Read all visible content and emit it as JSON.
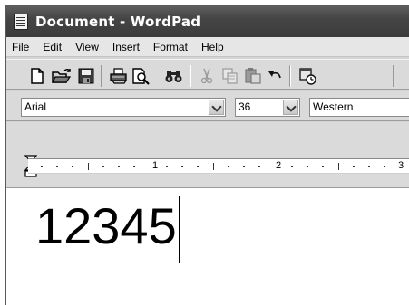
{
  "window": {
    "title": "Document - WordPad"
  },
  "menu": {
    "items": [
      {
        "underline": "F",
        "rest": "ile"
      },
      {
        "underline": "E",
        "rest": "dit"
      },
      {
        "underline": "V",
        "rest": "iew"
      },
      {
        "underline": "I",
        "rest": "nsert"
      },
      {
        "pre": "F",
        "underline": "o",
        "rest": "rmat"
      },
      {
        "underline": "H",
        "rest": "elp"
      }
    ]
  },
  "toolbar": {
    "buttons": [
      "new-icon",
      "open-icon",
      "save-icon",
      "print-icon",
      "print-preview-icon",
      "find-icon",
      "cut-icon",
      "copy-icon",
      "paste-icon",
      "undo-icon",
      "insert-datetime-icon"
    ]
  },
  "format": {
    "font": "Arial",
    "size": "36",
    "script": "Western"
  },
  "ruler": {
    "numbers": [
      "1",
      "2",
      "3"
    ]
  },
  "document": {
    "text": "12345"
  }
}
